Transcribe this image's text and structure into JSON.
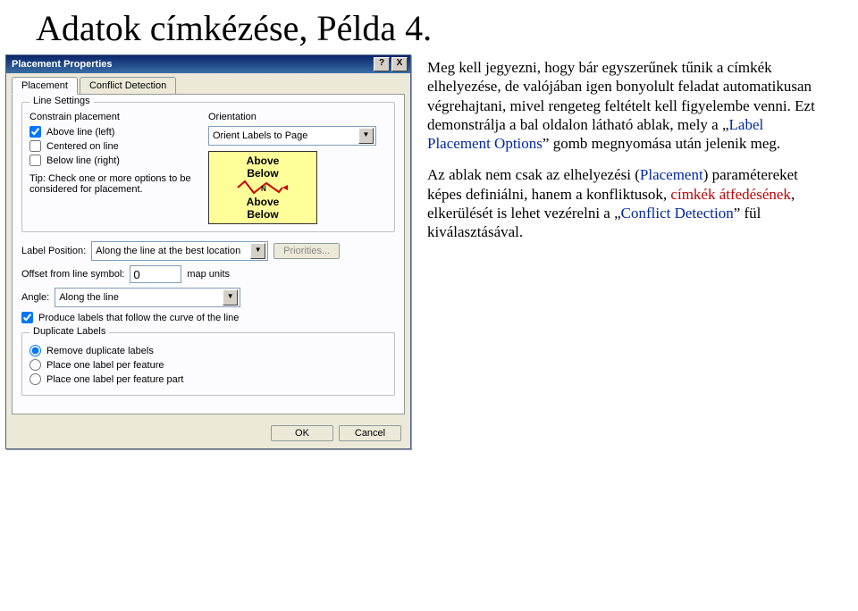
{
  "page_title": "Adatok címkézése, Példa 4.",
  "dialog": {
    "title": "Placement Properties",
    "help_button": "?",
    "close_button": "X",
    "tabs": {
      "placement": "Placement",
      "conflict": "Conflict Detection"
    },
    "line_settings": {
      "group_label": "Line Settings",
      "constrain_label": "Constrain placement",
      "orientation_label": "Orientation",
      "above_line": "Above line (left)",
      "centered": "Centered on line",
      "below_line": "Below line (right)",
      "orientation_value": "Orient Labels to Page",
      "tip": "Tip:  Check one or more options to be considered for placement.",
      "preview_above": "Above",
      "preview_below": "Below"
    },
    "label_position": {
      "label": "Label Position:",
      "value": "Along the line at the best location",
      "priorities_btn": "Priorities..."
    },
    "offset": {
      "label": "Offset from line symbol:",
      "value": "0",
      "units": "map units"
    },
    "angle": {
      "label": "Angle:",
      "value": "Along the line"
    },
    "follow_curve": "Produce labels that follow the curve of the line",
    "duplicate": {
      "group_label": "Duplicate Labels",
      "remove": "Remove duplicate labels",
      "per_feature": "Place one label per feature",
      "per_part": "Place one label per feature part"
    },
    "ok": "OK",
    "cancel": "Cancel"
  },
  "explain": {
    "p1_a": "Meg kell jegyezni, hogy bár egyszerűnek tűnik a címkék elhelyezése, de valójában igen bonyolult feladat automatikusan végrehajtani, mivel rengeteg feltételt kell figyelembe venni. Ezt demonstrálja a bal oldalon látható ablak, mely a „",
    "p1_term": "Label Placement Options",
    "p1_b": "” gomb megnyomása után jelenik meg.",
    "p2_a": "Az ablak nem csak az elhelyezési (",
    "p2_term1": "Placement",
    "p2_b": ") paramétereket képes definiálni, hanem a konfliktusok, ",
    "p2_term2": "címkék átfedésének",
    "p2_c": ", elkerülését is lehet vezérelni a „",
    "p2_term3": "Conflict Detection",
    "p2_d": "” fül kiválasztásával."
  }
}
